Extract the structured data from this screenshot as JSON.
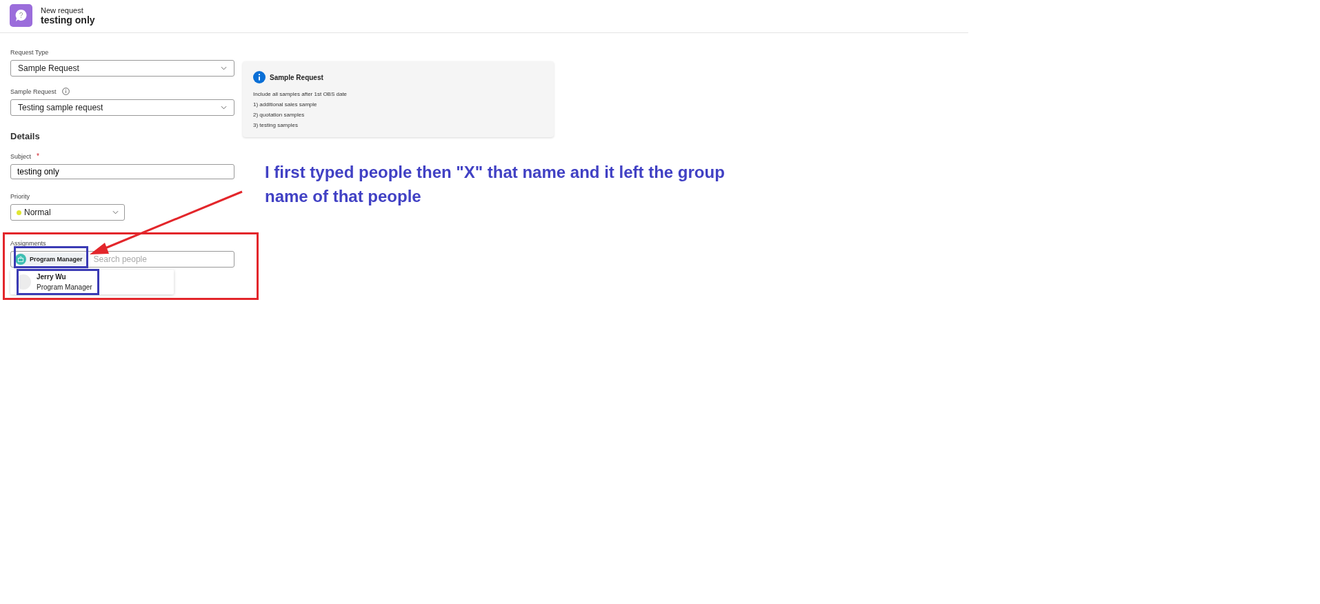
{
  "header": {
    "subtitle": "New request",
    "title": "testing only"
  },
  "form": {
    "request_type": {
      "label": "Request Type",
      "value": "Sample Request"
    },
    "sample_request": {
      "label": "Sample Request",
      "value": "Testing sample request"
    },
    "details_heading": "Details",
    "subject": {
      "label": "Subject",
      "required_mark": "*",
      "value": "testing only"
    },
    "priority": {
      "label": "Priority",
      "value": "Normal",
      "color": "#e0e632"
    },
    "assignments": {
      "label": "Assignments",
      "chips": [
        {
          "label": "Program Manager"
        }
      ],
      "placeholder": "Search people",
      "suggestions": [
        {
          "name": "Jerry Wu",
          "role": "Program Manager"
        }
      ]
    }
  },
  "info_card": {
    "title": "Sample Request",
    "lines": [
      "Include all samples after 1st OBS date",
      "1) additional sales sample",
      "2) quotation samples",
      "3) testing samples"
    ]
  },
  "annotation": {
    "note": "I first typed people then \"X\" that name and it left the group name of that people"
  }
}
